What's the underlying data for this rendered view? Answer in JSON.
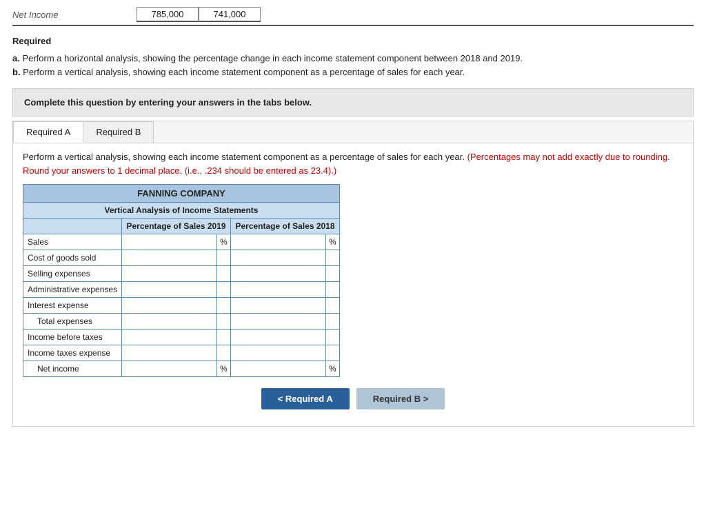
{
  "top": {
    "net_income_label": "Net Income",
    "value1": "785,000",
    "value2": "741,000"
  },
  "required_heading": "Required",
  "instructions": [
    {
      "label": "a.",
      "text": " Perform a horizontal analysis, showing the percentage change in each income statement component between 2018 and 2019."
    },
    {
      "label": "b.",
      "text": " Perform a vertical analysis, showing each income statement component as a percentage of sales for each year."
    }
  ],
  "complete_box": "Complete this question by entering your answers in the tabs below.",
  "tabs": [
    {
      "label": "Required A",
      "active": true
    },
    {
      "label": "Required B",
      "active": false
    }
  ],
  "description_main": "Perform a vertical analysis, showing each income statement component as a percentage of sales for each year.",
  "description_red": "(Percentages may not add exactly due to rounding. Round your answers to 1 decimal place. (i.e., .234 should be entered as 23.4).)",
  "table": {
    "company": "FANNING COMPANY",
    "subtitle": "Vertical Analysis of Income Statements",
    "col1": "Percentage of Sales 2019",
    "col2": "Percentage of Sales 2018",
    "rows": [
      {
        "label": "Sales",
        "indented": false,
        "show_pct": true
      },
      {
        "label": "Cost of goods sold",
        "indented": false,
        "show_pct": false
      },
      {
        "label": "Selling expenses",
        "indented": false,
        "show_pct": false
      },
      {
        "label": "Administrative expenses",
        "indented": false,
        "show_pct": false
      },
      {
        "label": "Interest expense",
        "indented": false,
        "show_pct": false
      },
      {
        "label": "Total expenses",
        "indented": true,
        "show_pct": false
      },
      {
        "label": "Income before taxes",
        "indented": false,
        "show_pct": false
      },
      {
        "label": "Income taxes expense",
        "indented": false,
        "show_pct": false
      },
      {
        "label": "Net income",
        "indented": true,
        "show_pct": true
      }
    ]
  },
  "nav_buttons": {
    "prev": "< Required A",
    "next": "Required B >"
  }
}
